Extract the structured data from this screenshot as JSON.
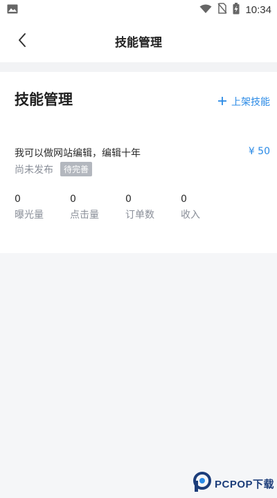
{
  "status_bar": {
    "time": "10:34",
    "icons": [
      "image-icon",
      "wifi-icon",
      "no-sim-icon",
      "battery-charging-icon"
    ]
  },
  "header": {
    "title": "技能管理",
    "back_icon": "chevron-left-icon"
  },
  "card": {
    "title": "技能管理",
    "add_button": {
      "icon": "plus-icon",
      "label": "上架技能"
    },
    "skill": {
      "name": "我可以做网站编辑，编辑十年",
      "price": "¥ 50",
      "status": "尚未发布",
      "badge": "待完善",
      "stats": [
        {
          "value": "0",
          "label": "曝光量"
        },
        {
          "value": "0",
          "label": "点击量"
        },
        {
          "value": "0",
          "label": "订单数"
        },
        {
          "value": "0",
          "label": "收入"
        }
      ]
    }
  },
  "watermark": {
    "text": "PCPOP下载"
  },
  "colors": {
    "accent": "#2a8ae6",
    "background": "#f5f6f8",
    "badge": "#b3b7be",
    "secondary_text": "#8a8f99"
  }
}
